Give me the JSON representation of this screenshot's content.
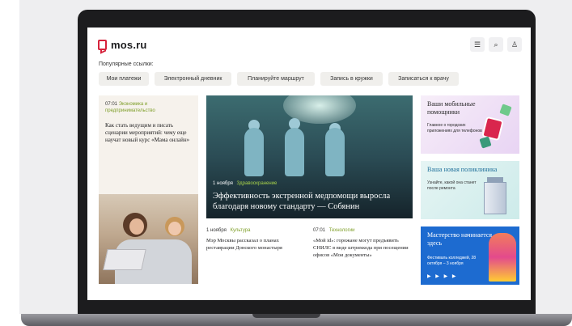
{
  "site": {
    "logo_text": "mos.ru"
  },
  "header": {
    "menu_icon": "menu-icon",
    "search_icon": "search-icon",
    "profile_icon": "profile-icon"
  },
  "popular": {
    "label": "Популярные ссылки:",
    "links": [
      "Мои платежи",
      "Электронный дневник",
      "Планируйте маршрут",
      "Запись в кружки",
      "Записаться к врачу"
    ]
  },
  "left_card": {
    "time": "07:01",
    "category": "Экономика и предпринимательство",
    "title": "Как стать ведущим и писать сценарии мероприятий: чему еще научат новый курс «Мама онлайн»"
  },
  "hero": {
    "date": "1 ноября",
    "category": "Здравоохранение",
    "title": "Эффективность экстренной медпомощи выросла благодаря новому стандарту — Собянин"
  },
  "news": [
    {
      "date": "1 ноября",
      "category": "Культура",
      "title": "Мэр Москвы рассказал о планах реставрации Донского монастыря"
    },
    {
      "date": "07:01",
      "category": "Технологии",
      "title": "«Мой id»: горожане могут предъявить СНИЛС в виде штрихкода при посещении офисов «Мои документы»"
    }
  ],
  "promos": [
    {
      "title": "Ваши мобильные помощники",
      "subtitle": "Главное о городских приложениях для телефонов"
    },
    {
      "title": "Ваша новая поликлиника",
      "subtitle": "Узнайте, какой она станет после ремонта"
    },
    {
      "title": "Мастерство начинается здесь",
      "subtitle": "Фестиваль колледжей, 28 октября – 3 ноября",
      "arrows": "▶ ▶ ▶ ▶"
    }
  ],
  "colors": {
    "brand": "#d6233c",
    "tag_green": "#7f9f2a",
    "promo_blue": "#1d6bd0"
  }
}
